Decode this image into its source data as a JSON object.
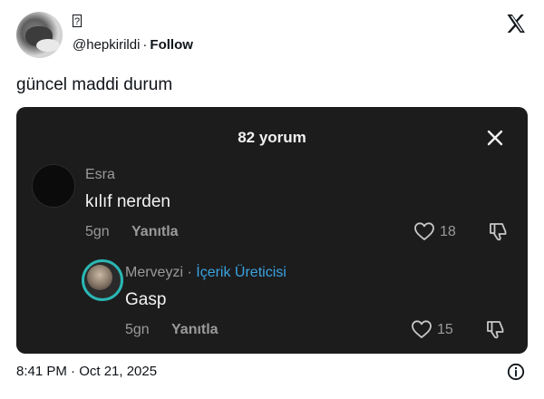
{
  "tweet": {
    "display_name": "?",
    "handle": "@hepkirildi",
    "separator": "·",
    "follow_label": "Follow",
    "text": "güncel maddi durum",
    "timestamp": "8:41 PM · Oct 21, 2025"
  },
  "embedded": {
    "title": "82 yorum",
    "comments": [
      {
        "username": "Esra",
        "text": "kılıf nerden",
        "age": "5gn",
        "reply_label": "Yanıtla",
        "likes": "18"
      },
      {
        "username": "Merveyzi",
        "separator": "·",
        "badge": "İçerik Üreticisi",
        "text": "Gasp",
        "age": "5gn",
        "reply_label": "Yanıtla",
        "likes": "15"
      }
    ]
  },
  "colors": {
    "card_bg": "#1c1c1d",
    "creator_badge": "#3aa3e0",
    "avatar_ring": "#2ab7b4",
    "muted": "#9a9a9a"
  },
  "icons": [
    "x-logo-icon",
    "close-icon",
    "heart-icon",
    "dislike-icon",
    "info-icon"
  ]
}
